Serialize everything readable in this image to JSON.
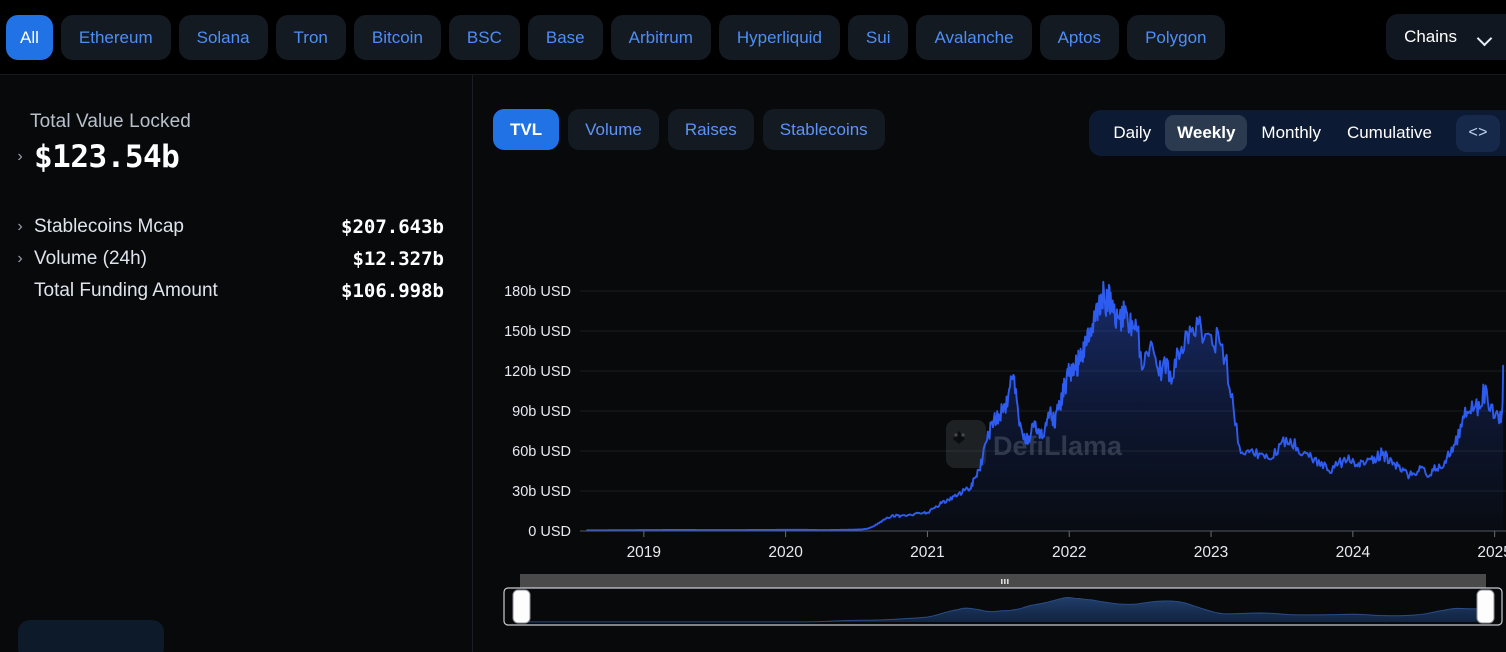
{
  "chains_bar": {
    "items": [
      {
        "label": "All",
        "active": true
      },
      {
        "label": "Ethereum",
        "active": false
      },
      {
        "label": "Solana",
        "active": false
      },
      {
        "label": "Tron",
        "active": false
      },
      {
        "label": "Bitcoin",
        "active": false
      },
      {
        "label": "BSC",
        "active": false
      },
      {
        "label": "Base",
        "active": false
      },
      {
        "label": "Arbitrum",
        "active": false
      },
      {
        "label": "Hyperliquid",
        "active": false
      },
      {
        "label": "Sui",
        "active": false
      },
      {
        "label": "Avalanche",
        "active": false
      },
      {
        "label": "Aptos",
        "active": false
      },
      {
        "label": "Polygon",
        "active": false
      }
    ],
    "dropdown_label": "Chains"
  },
  "stats": {
    "tvl_label": "Total Value Locked",
    "tvl_value": "$123.54b",
    "rows": [
      {
        "name": "Stablecoins Mcap",
        "value": "$207.643b",
        "expandable": true
      },
      {
        "name": "Volume (24h)",
        "value": "$12.327b",
        "expandable": true
      },
      {
        "name": "Total Funding Amount",
        "value": "$106.998b",
        "expandable": false
      }
    ]
  },
  "chart_tabs": [
    {
      "label": "TVL",
      "active": true
    },
    {
      "label": "Volume",
      "active": false
    },
    {
      "label": "Raises",
      "active": false
    },
    {
      "label": "Stablecoins",
      "active": false
    }
  ],
  "intervals": [
    {
      "label": "Daily",
      "active": false
    },
    {
      "label": "Weekly",
      "active": true
    },
    {
      "label": "Monthly",
      "active": false
    },
    {
      "label": "Cumulative",
      "active": false
    }
  ],
  "code_button_label": "<>",
  "watermark": "DefiLlama",
  "colors": {
    "accent": "#2172e5",
    "line": "#2f5cf0",
    "pill_bg": "#141a22",
    "pill_text": "#4d8ef7",
    "panel_bg": "#07090b",
    "grid": "#1a1d22",
    "interval_bg": "#0c1a33"
  },
  "chart_data": {
    "type": "area",
    "title": "Total Value Locked",
    "xlabel": "",
    "ylabel": "USD",
    "unit": "b USD",
    "grid": true,
    "legend": null,
    "ylim": [
      0,
      195
    ],
    "yticks": [
      0,
      30,
      60,
      90,
      120,
      150,
      180
    ],
    "ytick_labels": [
      "0 USD",
      "30b USD",
      "60b USD",
      "90b USD",
      "120b USD",
      "150b USD",
      "180b USD"
    ],
    "xticks": [
      2019,
      2020,
      2021,
      2022,
      2023,
      2024,
      2025
    ],
    "xtick_labels": [
      "2019",
      "2020",
      "2021",
      "2022",
      "2023",
      "2024",
      "2025"
    ],
    "xlim": [
      2018.55,
      2025.08
    ],
    "series": [
      {
        "name": "TVL",
        "x": [
          2018.6,
          2018.7,
          2018.8,
          2018.9,
          2019.0,
          2019.1,
          2019.2,
          2019.3,
          2019.4,
          2019.5,
          2019.6,
          2019.7,
          2019.8,
          2019.9,
          2020.0,
          2020.06,
          2020.12,
          2020.18,
          2020.24,
          2020.3,
          2020.36,
          2020.42,
          2020.48,
          2020.54,
          2020.58,
          2020.62,
          2020.66,
          2020.7,
          2020.74,
          2020.78,
          2020.82,
          2020.86,
          2020.9,
          2020.94,
          2020.98,
          2021.02,
          2021.06,
          2021.1,
          2021.14,
          2021.18,
          2021.22,
          2021.26,
          2021.3,
          2021.33,
          2021.36,
          2021.39,
          2021.42,
          2021.45,
          2021.48,
          2021.51,
          2021.54,
          2021.57,
          2021.6,
          2021.63,
          2021.66,
          2021.69,
          2021.72,
          2021.75,
          2021.78,
          2021.81,
          2021.84,
          2021.86,
          2021.88,
          2021.9,
          2021.92,
          2021.94,
          2021.96,
          2021.98,
          2022.0,
          2022.02,
          2022.04,
          2022.06,
          2022.08,
          2022.1,
          2022.12,
          2022.14,
          2022.16,
          2022.18,
          2022.2,
          2022.22,
          2022.24,
          2022.26,
          2022.28,
          2022.3,
          2022.33,
          2022.36,
          2022.39,
          2022.42,
          2022.45,
          2022.48,
          2022.52,
          2022.56,
          2022.6,
          2022.64,
          2022.68,
          2022.72,
          2022.76,
          2022.8,
          2022.85,
          2022.9,
          2022.95,
          2023.0,
          2023.05,
          2023.1,
          2023.15,
          2023.2,
          2023.25,
          2023.3,
          2023.35,
          2023.4,
          2023.45,
          2023.5,
          2023.55,
          2023.6,
          2023.65,
          2023.7,
          2023.75,
          2023.8,
          2023.85,
          2023.9,
          2023.95,
          2024.0,
          2024.04,
          2024.08,
          2024.12,
          2024.16,
          2024.2,
          2024.24,
          2024.28,
          2024.32,
          2024.36,
          2024.4,
          2024.44,
          2024.48,
          2024.52,
          2024.56,
          2024.6,
          2024.64,
          2024.68,
          2024.72,
          2024.76,
          2024.8,
          2024.84,
          2024.88,
          2024.92,
          2024.96,
          2025.0,
          2025.04,
          2025.06
        ],
        "y": [
          0.5,
          0.5,
          0.6,
          0.6,
          0.7,
          0.7,
          0.8,
          0.8,
          0.7,
          0.7,
          0.7,
          0.7,
          0.8,
          0.8,
          0.9,
          0.9,
          0.9,
          0.8,
          0.7,
          0.7,
          0.8,
          0.9,
          1.0,
          1.2,
          1.8,
          3.5,
          6.0,
          9.0,
          11.0,
          11.5,
          11.0,
          12.0,
          12.5,
          13.0,
          13.5,
          15.0,
          18.0,
          21.0,
          23.0,
          26.0,
          27.0,
          30.0,
          33.0,
          38.0,
          45.0,
          55.0,
          68.0,
          78.0,
          84.0,
          88.0,
          91.0,
          97.0,
          120.0,
          94.0,
          75.0,
          66.0,
          72.0,
          80.0,
          77.0,
          72.0,
          80.0,
          88.0,
          86.0,
          82.0,
          90.0,
          95.0,
          105.0,
          112.0,
          118.0,
          122.0,
          126.0,
          125.0,
          130.0,
          136.0,
          142.0,
          150.0,
          146.0,
          158.0,
          165.0,
          172.0,
          178.0,
          170.0,
          176.0,
          168.0,
          162.0,
          158.0,
          164.0,
          156.0,
          152.0,
          148.0,
          126.0,
          136.0,
          128.0,
          120.0,
          125.0,
          118.0,
          132.0,
          140.0,
          152.0,
          155.0,
          148.0,
          146.0,
          142.0,
          130.0,
          100.0,
          62.0,
          58.0,
          62.0,
          56.0,
          53.0,
          60.0,
          66.0,
          70.0,
          64.0,
          58.0,
          56.0,
          52.0,
          48.0,
          46.0,
          50.0,
          54.0,
          52.0,
          48.0,
          52.0,
          56.0,
          54.0,
          58.0,
          55.0,
          50.0,
          48.0,
          44.0,
          42.0,
          44.0,
          46.0,
          43.0,
          45.0,
          48.0,
          52.0,
          58.0,
          64.0,
          76.0,
          90.0,
          96.0,
          92.0,
          104.0,
          98.0,
          88.0,
          84.0,
          92.0,
          96.0,
          93.0,
          132.0,
          120.0,
          124.0
        ]
      }
    ],
    "brush": {
      "selected_range": [
        2018.55,
        2025.08
      ],
      "full_range": [
        2018.55,
        2025.08
      ]
    }
  }
}
